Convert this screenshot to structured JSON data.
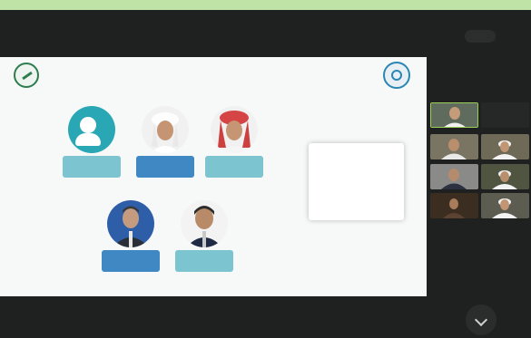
{
  "slide": {
    "title_line1": "",
    "title_line2": "",
    "info_card": {
      "line1": "",
      "line2": "",
      "line3": "",
      "line4": ""
    }
  },
  "speakers": [
    {
      "label": ""
    },
    {
      "label": ""
    },
    {
      "label": ""
    },
    {
      "label": ""
    },
    {
      "label": ""
    }
  ],
  "participants": [
    {
      "label": ""
    },
    {
      "label": ""
    },
    {
      "label": ""
    },
    {
      "label": ""
    },
    {
      "label": ""
    },
    {
      "label": ""
    },
    {
      "label": ""
    },
    {
      "label": ""
    }
  ],
  "colors": {
    "top_bar": "#bfe3a7",
    "meeting_bg": "#1f2020",
    "slide_bg": "#f7f9f9",
    "tag_teal": "#7cc4cf",
    "tag_blue": "#3f88c4"
  }
}
